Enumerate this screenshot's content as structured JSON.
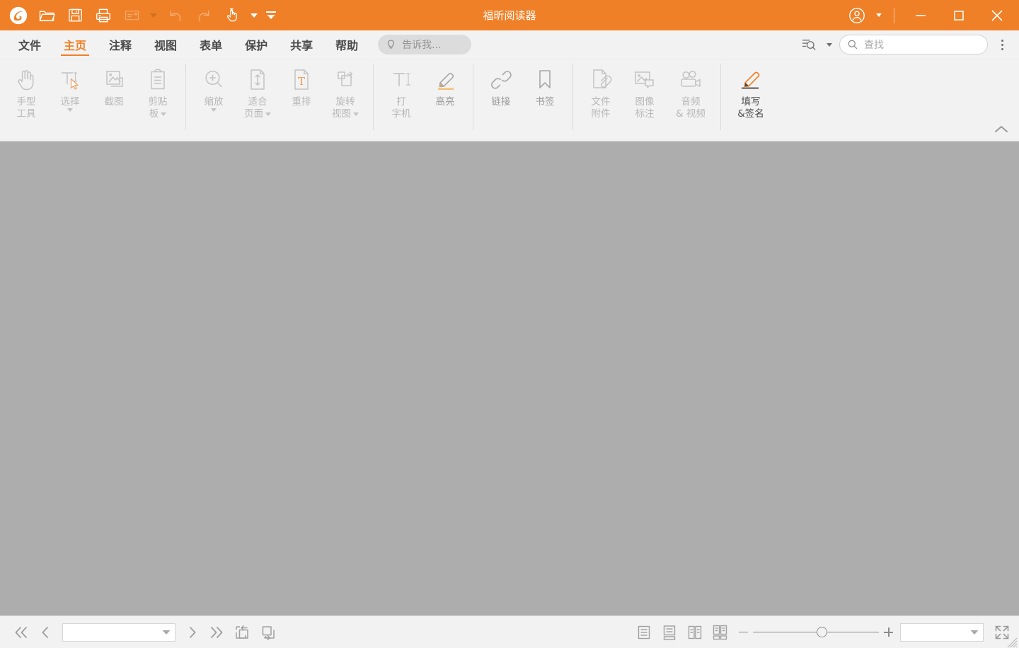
{
  "window": {
    "title": "福昕阅读器",
    "accent_color": "#ef8027",
    "document_bg": "#adadad",
    "quick_access": [
      {
        "name": "app-logo-icon",
        "label": "福昕"
      },
      {
        "name": "open-icon",
        "label": "打开"
      },
      {
        "name": "save-icon",
        "label": "保存"
      },
      {
        "name": "print-icon",
        "label": "打印"
      },
      {
        "name": "email-icon",
        "label": "电子邮件"
      },
      {
        "name": "undo-icon",
        "label": "撤销"
      },
      {
        "name": "redo-icon",
        "label": "重做"
      },
      {
        "name": "hand-click-icon",
        "label": "手型工具"
      },
      {
        "name": "customize-toolbar-icon",
        "label": "自定义"
      }
    ],
    "controls": {
      "account": "账户",
      "minimize": "最小化",
      "maximize": "最大化",
      "close": "关闭"
    }
  },
  "menubar": {
    "tabs": [
      {
        "label": "文件",
        "active": false
      },
      {
        "label": "主页",
        "active": true
      },
      {
        "label": "注释",
        "active": false
      },
      {
        "label": "视图",
        "active": false
      },
      {
        "label": "表单",
        "active": false
      },
      {
        "label": "保护",
        "active": false
      },
      {
        "label": "共享",
        "active": false
      },
      {
        "label": "帮助",
        "active": false
      }
    ],
    "tellme": {
      "placeholder": "告诉我...",
      "value": "",
      "icon": "lightbulb-icon"
    },
    "search": {
      "placeholder": "查找",
      "value": "",
      "icon": "search-icon"
    },
    "advanced_search_icon": "advanced-search-icon",
    "overflow_icon": "kebab-menu-icon"
  },
  "ribbon": {
    "collapse_label": "折叠功能区",
    "groups": [
      {
        "buttons": [
          {
            "icon": "hand-tool-icon",
            "lines": [
              "手型",
              "工具"
            ],
            "dropdown": false,
            "state": "disabled"
          },
          {
            "icon": "select-text-icon",
            "lines": [
              "选择"
            ],
            "dropdown": true,
            "state": "disabled"
          },
          {
            "icon": "snapshot-icon",
            "lines": [
              "截图"
            ],
            "dropdown": false,
            "state": "disabled"
          },
          {
            "icon": "clipboard-icon",
            "lines": [
              "剪贴",
              "板"
            ],
            "dropdown": true,
            "state": "disabled"
          }
        ]
      },
      {
        "buttons": [
          {
            "icon": "zoom-icon",
            "lines": [
              "缩放"
            ],
            "dropdown": true,
            "state": "disabled"
          },
          {
            "icon": "fit-page-icon",
            "lines": [
              "适合",
              "页面"
            ],
            "dropdown": true,
            "state": "disabled"
          },
          {
            "icon": "reflow-icon",
            "lines": [
              "重排"
            ],
            "dropdown": false,
            "state": "disabled"
          },
          {
            "icon": "rotate-view-icon",
            "lines": [
              "旋转",
              "视图"
            ],
            "dropdown": true,
            "state": "disabled"
          }
        ]
      },
      {
        "buttons": [
          {
            "icon": "typewriter-icon",
            "lines": [
              "打",
              "字机"
            ],
            "dropdown": false,
            "state": "disabled"
          },
          {
            "icon": "highlight-icon",
            "lines": [
              "高亮"
            ],
            "dropdown": false,
            "state": "semi"
          }
        ]
      },
      {
        "buttons": [
          {
            "icon": "link-icon",
            "lines": [
              "链接"
            ],
            "dropdown": false,
            "state": "semi"
          },
          {
            "icon": "bookmark-icon",
            "lines": [
              "书签"
            ],
            "dropdown": false,
            "state": "semi"
          }
        ]
      },
      {
        "buttons": [
          {
            "icon": "file-attachment-icon",
            "lines": [
              "文件",
              "附件"
            ],
            "dropdown": false,
            "state": "disabled"
          },
          {
            "icon": "image-annotation-icon",
            "lines": [
              "图像",
              "标注"
            ],
            "dropdown": false,
            "state": "disabled"
          },
          {
            "icon": "audio-video-icon",
            "lines": [
              "音频",
              "& 视频"
            ],
            "dropdown": false,
            "state": "disabled"
          }
        ]
      },
      {
        "buttons": [
          {
            "icon": "fill-and-sign-icon",
            "lines": [
              "填写",
              "&签名"
            ],
            "dropdown": false,
            "state": "active"
          }
        ]
      }
    ]
  },
  "statusbar": {
    "first_page_label": "第一页",
    "prev_page_label": "上一页",
    "next_page_label": "下一页",
    "last_page_label": "最后一页",
    "page_input": {
      "value": "",
      "placeholder": ""
    },
    "page_nav_icons": [
      "previous-view-icon",
      "next-view-icon"
    ],
    "view_modes": [
      {
        "icon": "single-page-icon",
        "label": "单页"
      },
      {
        "icon": "continuous-page-icon",
        "label": "连续"
      },
      {
        "icon": "facing-page-icon",
        "label": "双页"
      },
      {
        "icon": "facing-continuous-icon",
        "label": "连续双页"
      }
    ],
    "zoom": {
      "minus_label": "缩小",
      "plus_label": "放大",
      "slider_percent": 55,
      "value": "",
      "placeholder": ""
    },
    "fullscreen_label": "全屏",
    "resize_grip_label": "调整大小"
  }
}
